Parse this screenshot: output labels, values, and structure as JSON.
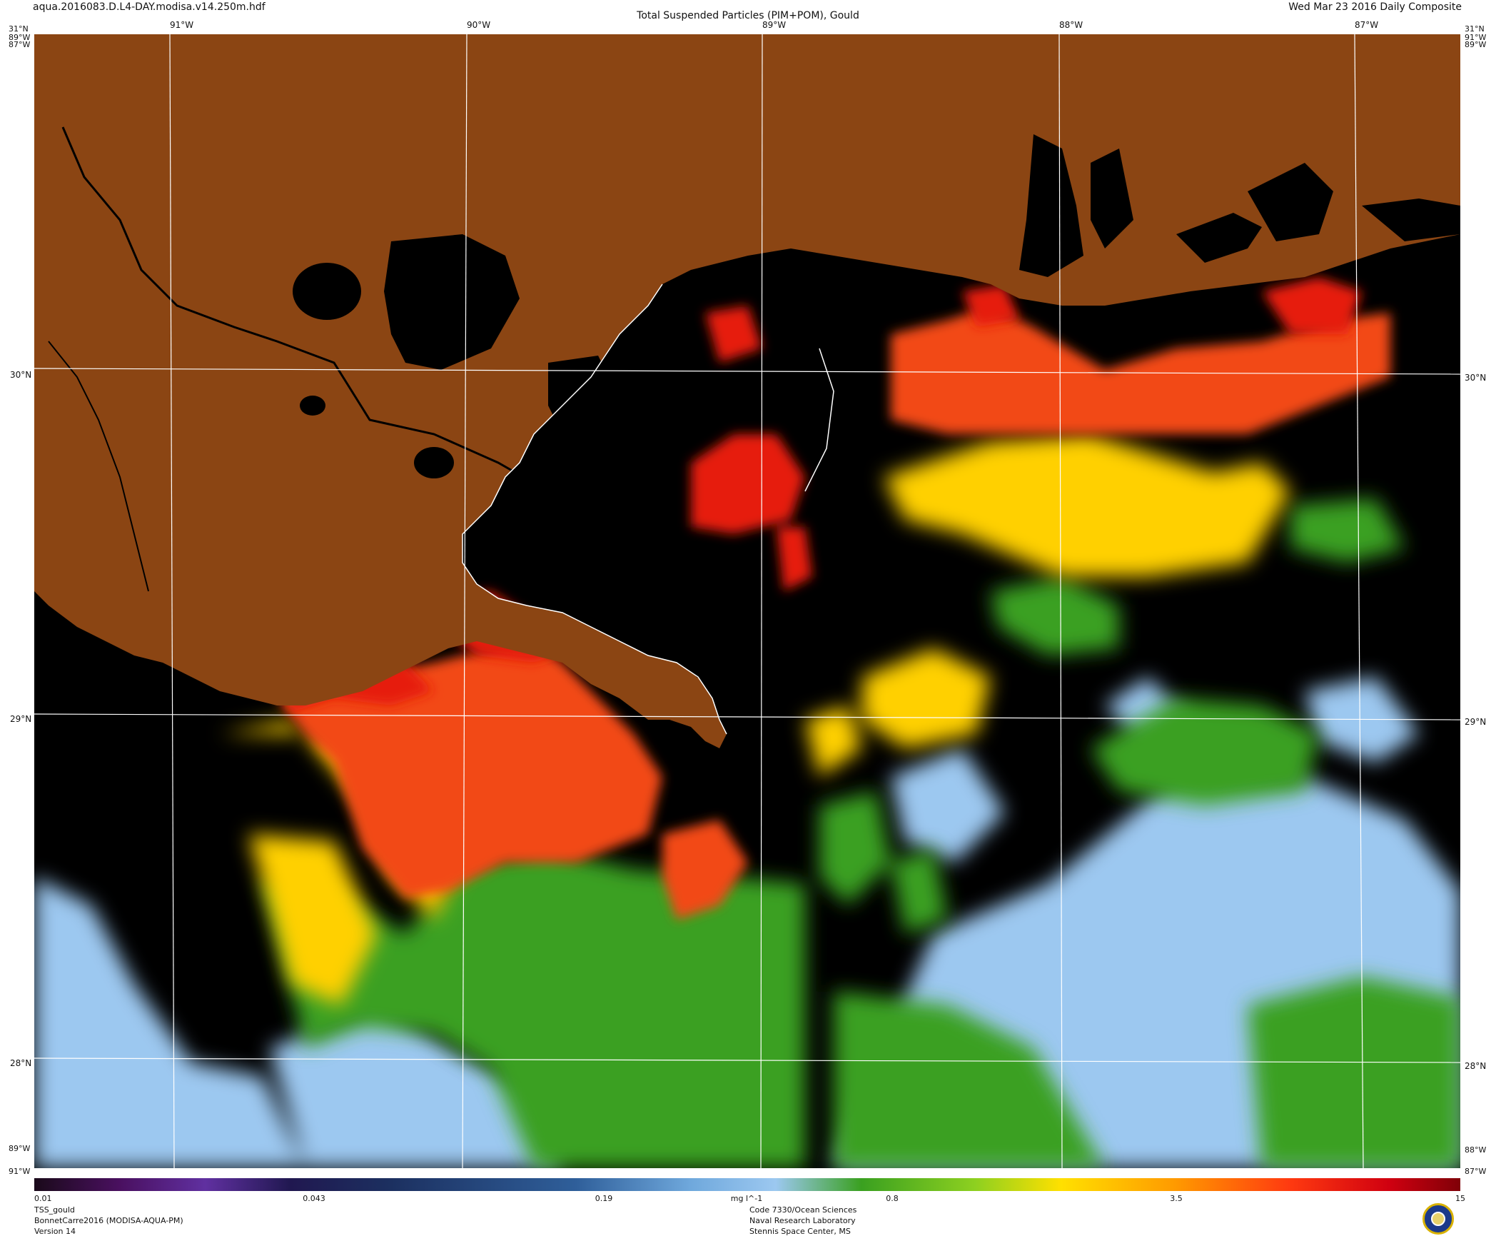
{
  "header": {
    "file": "aqua.2016083.D.L4-DAY.modisa.v14.250m.hdf",
    "title": "Total Suspended Particles (PIM+POM), Gould",
    "date": "Wed Mar 23 2016 Daily Composite"
  },
  "map": {
    "lon_labels": [
      "91°W",
      "90°W",
      "89°W",
      "88°W",
      "87°W"
    ],
    "lat_labels": [
      "31°N",
      "30°N",
      "29°N",
      "28°N"
    ],
    "corner_labels": {
      "top_left_lat": "31°N",
      "top_left_lon": "89°W",
      "top_left_lon2": "87°W",
      "top_right_lat": "31°N",
      "top_right_lon": "91°W",
      "top_right_lon2": "89°W",
      "bottom_left_lon": "89°W",
      "bottom_left_lon2": "91°W",
      "bottom_right_lon": "88°W",
      "bottom_right_lon2": "87°W"
    },
    "colors": {
      "land": "#8b4513",
      "no_data": "#000000",
      "high": "#e82010",
      "mid": "#ffd000",
      "low": "#3aa020",
      "very_low": "#9cc8f0",
      "grid": "#ffffff"
    }
  },
  "colorbar": {
    "ticks": [
      "0.01",
      "0.043",
      "0.19",
      "mg l^-1",
      "0.8",
      "3.5",
      "15"
    ],
    "min": 0.01,
    "max": 15,
    "scale": "log"
  },
  "footer": {
    "left": [
      "TSS_gould",
      "BonnetCarre2016 (MODISA-AQUA-PM)",
      "Version 14"
    ],
    "center": [
      "Code 7330/Ocean Sciences",
      "Naval Research Laboratory",
      "Stennis Space Center, MS"
    ]
  }
}
